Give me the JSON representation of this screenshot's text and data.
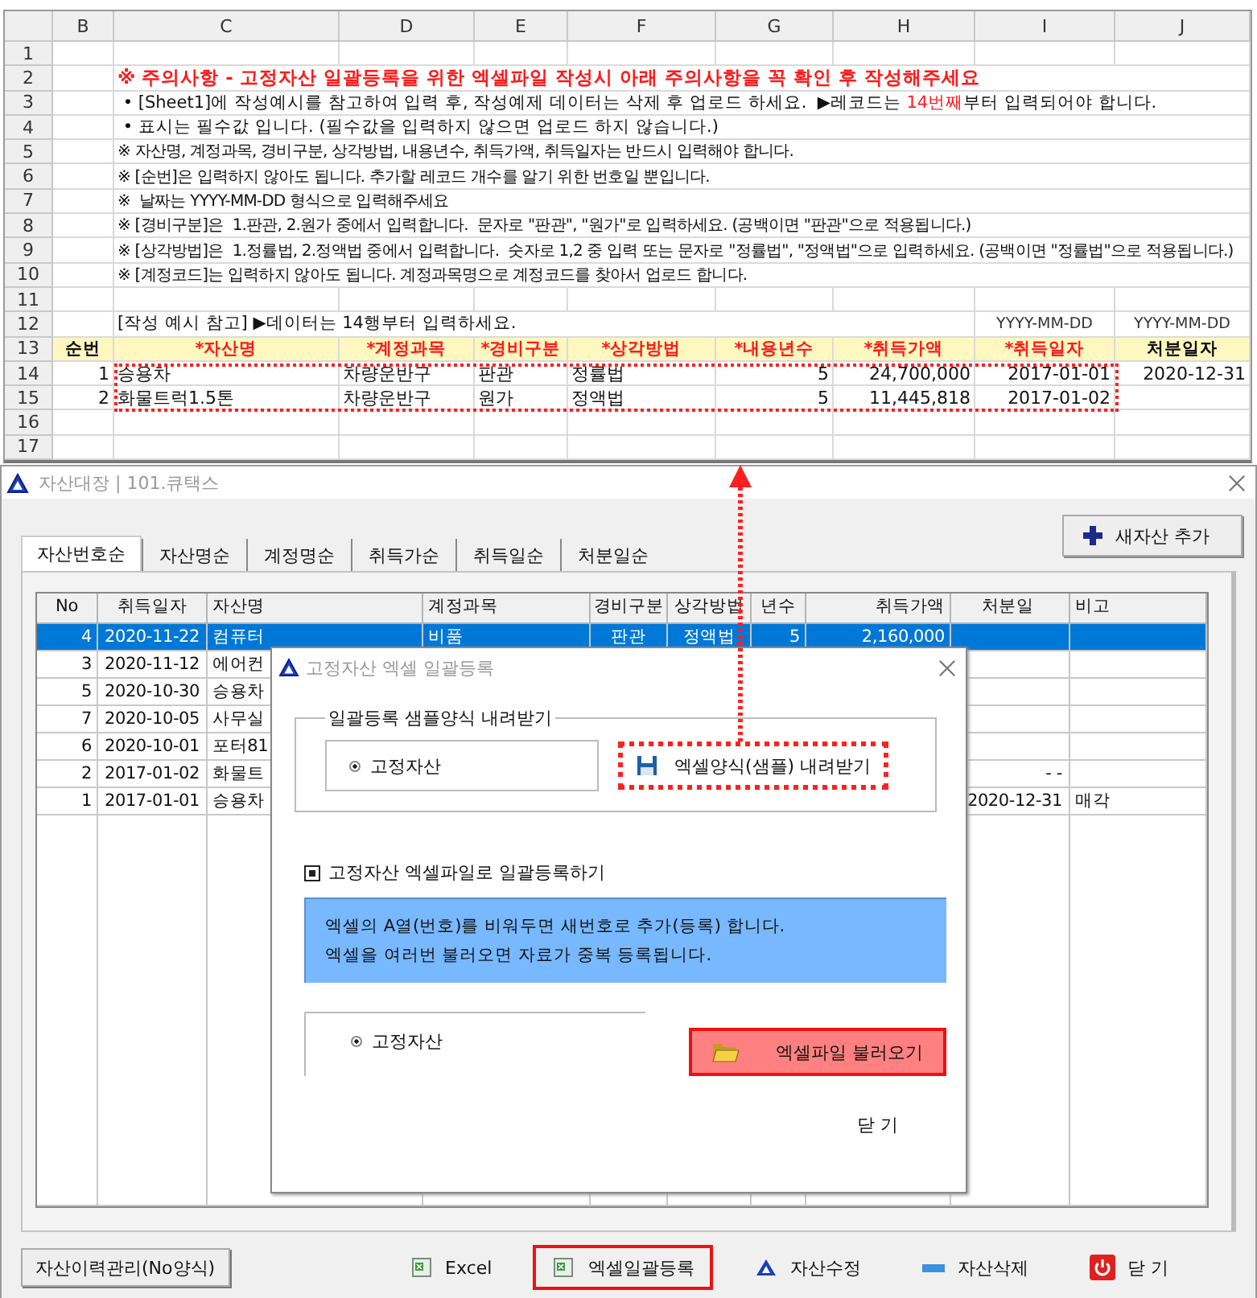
{
  "sheet": {
    "columns": [
      "B",
      "C",
      "D",
      "E",
      "F",
      "G",
      "H",
      "I",
      "J"
    ],
    "rows": [
      {
        "number": "1",
        "kind": "blank"
      },
      {
        "number": "2",
        "kind": "warning",
        "segments": [
          {
            "text": "※ 주의사항 - 고정자산 일괄등록을 위한 엑셀파일 작성시 아래 주의사항을 꼭 확인 후 작성해주세요",
            "highlight": true
          }
        ]
      },
      {
        "number": "3",
        "kind": "note",
        "segments": [
          {
            "text": " • [Sheet1]에 작성예시를 참고하여 입력 후, 작성예제 데이터는 삭제 후 업로드 하세요.  ▶레코드는 ",
            "highlight": false
          },
          {
            "text": "14번째",
            "highlight": true
          },
          {
            "text": "부터 입력되어야 합니다.",
            "highlight": false
          }
        ]
      },
      {
        "number": "4",
        "kind": "note",
        "segments": [
          {
            "text": " • 표시는 필수값 입니다. (필수값을 입력하지 않으면 업로드 하지 않습니다.)",
            "highlight": false
          }
        ]
      },
      {
        "number": "5",
        "kind": "fineprint",
        "segments": [
          {
            "text": "※ 자산명, 계정과목, 경비구분, 상각방법, 내용년수, 취득가액, 취득일자는 반드시 입력해야 합니다.",
            "highlight": false
          }
        ]
      },
      {
        "number": "6",
        "kind": "fineprint",
        "segments": [
          {
            "text": "※ [순번]은 입력하지 않아도 됩니다. 추가할 레코드 개수를 알기 위한 번호일 뿐입니다.",
            "highlight": false
          }
        ]
      },
      {
        "number": "7",
        "kind": "fineprint",
        "segments": [
          {
            "text": "※  날짜는 YYYY-MM-DD 형식으로 입력해주세요",
            "highlight": false
          }
        ]
      },
      {
        "number": "8",
        "kind": "fineprint",
        "segments": [
          {
            "text": "※ [경비구분]은  1.판관, 2.원가 중에서 입력합니다.  문자로 \"판관\", \"원가\"로 입력하세요. (공백이면 \"판관\"으로 적용됩니다.)",
            "highlight": false
          }
        ]
      },
      {
        "number": "9",
        "kind": "fineprint",
        "segments": [
          {
            "text": "※ [상각방법]은  1.정률법, 2.정액법 중에서 입력합니다.  숫자로 1,2 중 입력 또는 문자로 \"정률법\", \"정액법\"으로 입력하세요. (공백이면 \"정률법\"으로 적용됩니다.)",
            "highlight": false
          }
        ]
      },
      {
        "number": "10",
        "kind": "fineprint",
        "segments": [
          {
            "text": "※ [계정코드]는 입력하지 않아도 됩니다. 계정과목명으로 계정코드를 찾아서 업로드 합니다.",
            "highlight": false
          }
        ]
      },
      {
        "number": "11",
        "kind": "blank"
      },
      {
        "number": "12",
        "kind": "caption",
        "text": "[작성 예시 참고] ▶데이터는 14행부터 입력하세요.",
        "tail": [
          "YYYY-MM-DD",
          "YYYY-MM-DD"
        ]
      },
      {
        "number": "13",
        "kind": "header",
        "cells": [
          {
            "text": "순번",
            "required": false
          },
          {
            "text": "*자산명",
            "required": true
          },
          {
            "text": "*계정과목",
            "required": true
          },
          {
            "text": "*경비구분",
            "required": true
          },
          {
            "text": "*상각방법",
            "required": true
          },
          {
            "text": "*내용년수",
            "required": true
          },
          {
            "text": "*취득가액",
            "required": true
          },
          {
            "text": "*취득일자",
            "required": true
          },
          {
            "text": "처분일자",
            "required": false
          }
        ]
      },
      {
        "number": "14",
        "kind": "data",
        "cells": [
          "1",
          "승용차",
          "차량운반구",
          "판관",
          "정률법",
          "5",
          "24,700,000",
          "2017-01-01",
          "2020-12-31"
        ]
      },
      {
        "number": "15",
        "kind": "data",
        "cells": [
          "2",
          "화물트럭1.5톤",
          "차량운반구",
          "원가",
          "정액법",
          "5",
          "11,445,818",
          "2017-01-02",
          null
        ]
      },
      {
        "number": "16",
        "kind": "blank"
      },
      {
        "number": "17",
        "kind": "blank"
      }
    ]
  },
  "window": {
    "title": "자산대장 | 101.큐택스",
    "tabs": [
      {
        "label": "자산번호순",
        "selected": true
      },
      {
        "label": "자산명순",
        "selected": false
      },
      {
        "label": "계정명순",
        "selected": false
      },
      {
        "label": "취득가순",
        "selected": false
      },
      {
        "label": "취득일순",
        "selected": false
      },
      {
        "label": "처분일순",
        "selected": false
      }
    ],
    "add_button": "새자산 추가",
    "table": {
      "columns": [
        "No",
        "취득일자",
        "자산명",
        "계정과목",
        "경비구분",
        "상각방법",
        "년수",
        "취득가액",
        "처분일",
        "비고"
      ],
      "rows": [
        {
          "selected": true,
          "cells": [
            "4",
            "2020-11-22",
            "컴퓨터",
            "비품",
            "판관",
            "정액법",
            "5",
            "2,160,000",
            null,
            null
          ]
        },
        {
          "selected": false,
          "cells": [
            "3",
            "2020-11-12",
            "에어컨",
            null,
            null,
            null,
            null,
            null,
            null,
            null
          ]
        },
        {
          "selected": false,
          "cells": [
            "5",
            "2020-10-30",
            "승용차",
            null,
            null,
            null,
            null,
            null,
            null,
            null
          ]
        },
        {
          "selected": false,
          "cells": [
            "7",
            "2020-10-05",
            "사무실",
            null,
            null,
            null,
            null,
            null,
            null,
            null
          ]
        },
        {
          "selected": false,
          "cells": [
            "6",
            "2020-10-01",
            "포터81",
            null,
            null,
            null,
            null,
            null,
            null,
            null
          ]
        },
        {
          "selected": false,
          "cells": [
            "2",
            "2017-01-02",
            "화물트",
            null,
            null,
            null,
            null,
            null,
            "- -",
            null
          ]
        },
        {
          "selected": false,
          "cells": [
            "1",
            "2017-01-01",
            "승용차",
            null,
            null,
            null,
            null,
            null,
            "2020-12-31",
            "매각"
          ]
        }
      ]
    },
    "history_button": "자산이력관리(No양식)",
    "actions": [
      {
        "label": "Excel",
        "kind": "excel",
        "highlighted": false
      },
      {
        "label": "엑셀일괄등록",
        "kind": "excel",
        "highlighted": true
      },
      {
        "label": "자산수정",
        "kind": "edit",
        "highlighted": false
      },
      {
        "label": "자산삭제",
        "kind": "delete",
        "highlighted": false
      },
      {
        "label": "닫 기",
        "kind": "close",
        "highlighted": false
      }
    ]
  },
  "dialog": {
    "title": "고정자산 엑셀 일괄등록",
    "download_group": {
      "legend": "일괄등록 샘플양식 내려받기",
      "radio": {
        "label": "고정자산",
        "selected": true
      },
      "button": {
        "label": "엑셀양식(샘플) 내려받기",
        "highlighted": true
      }
    },
    "upload_label": "고정자산 엑셀파일로 일괄등록하기",
    "info_lines": [
      "엑셀의 A열(번호)를 비워두면 새번호로 추가(등록) 합니다.",
      "엑셀을 여러번 불러오면 자료가 중복 등록됩니다."
    ],
    "upload_radio": {
      "label": "고정자산",
      "selected": true
    },
    "load_button": {
      "label": "엑셀파일 불러오기",
      "highlighted": true
    },
    "close_button": "닫 기"
  }
}
